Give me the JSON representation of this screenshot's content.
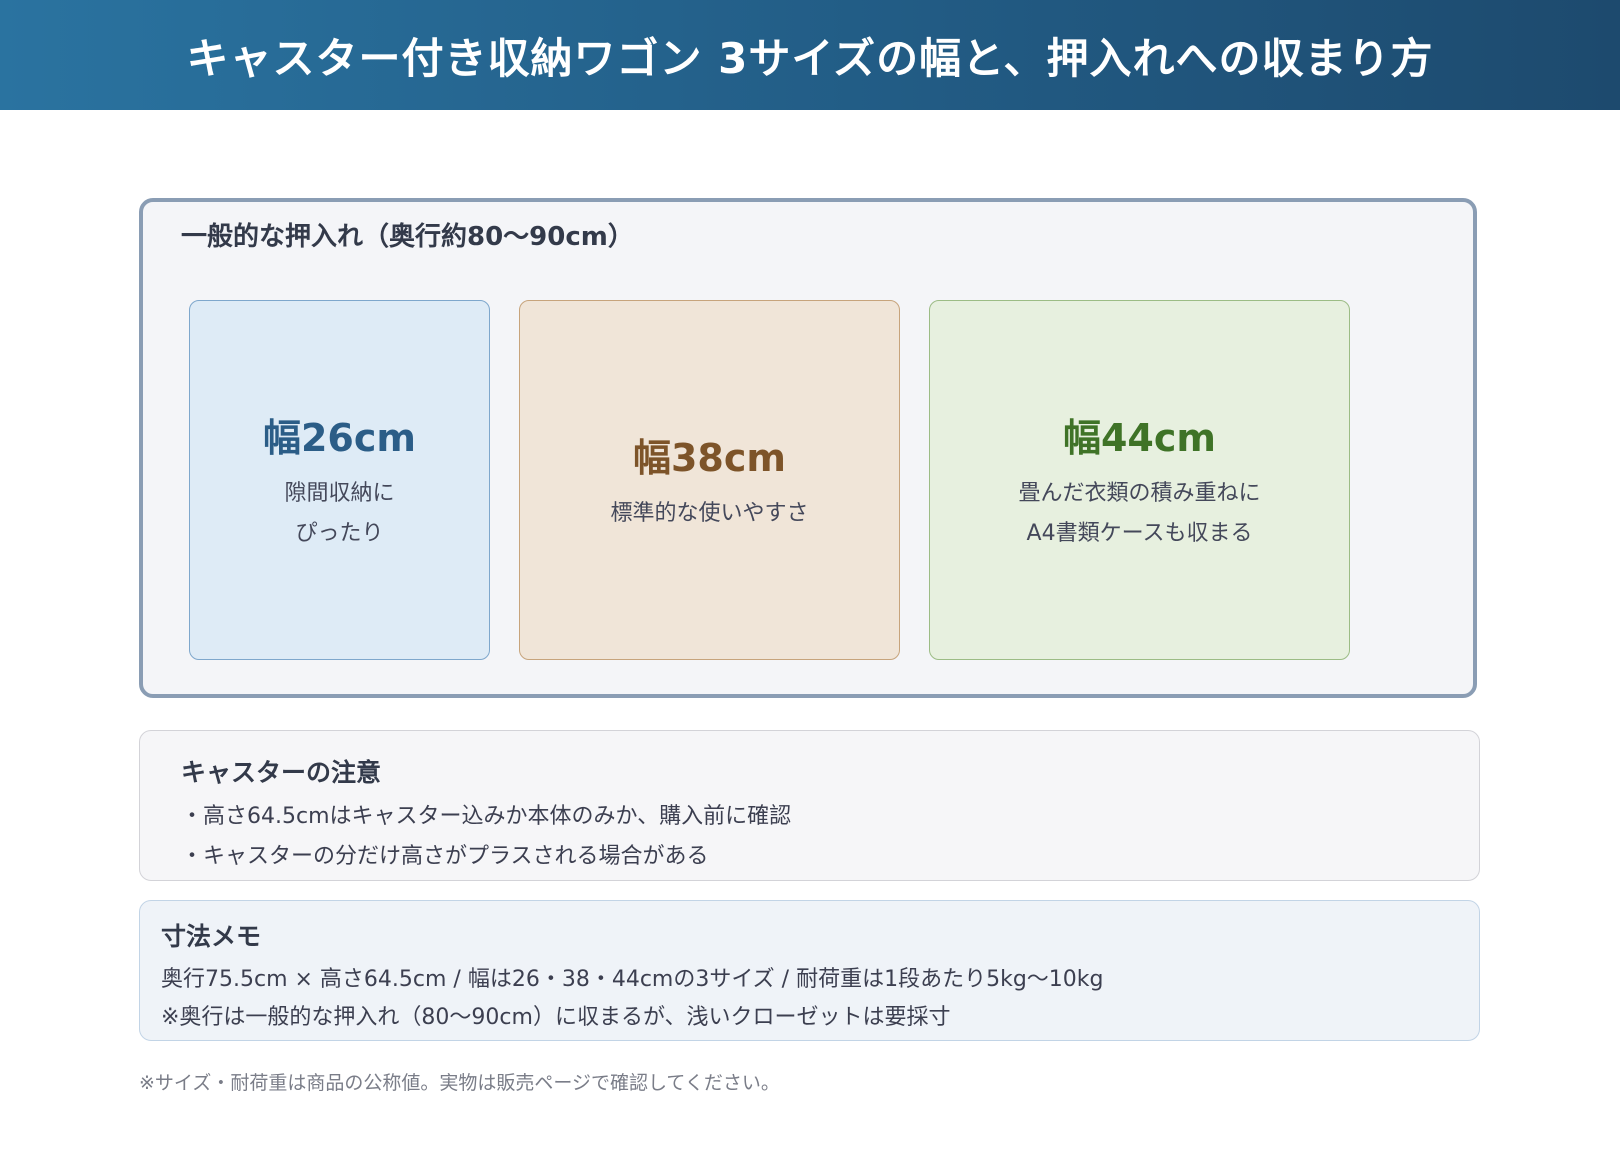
{
  "header": {
    "title": "キャスター付き収納ワゴン 3サイズの幅と、押入れへの収まり方",
    "colors": {
      "gradient_start": "#2a73a0",
      "gradient_end": "#1d4a6e"
    }
  },
  "closet": {
    "label": "一般的な押入れ（奥行約80〜90cm）",
    "wagons": [
      {
        "width_label": "幅26cm",
        "desc": [
          "隙間収納に",
          "ぴったり"
        ],
        "color": "#2b5d87",
        "fill": "#deebf6"
      },
      {
        "width_label": "幅38cm",
        "desc": [
          "標準的な使いやすさ"
        ],
        "color": "#7d5429",
        "fill": "#f0e5d8"
      },
      {
        "width_label": "幅44cm",
        "desc": [
          "畳んだ衣類の積み重ねに",
          "A4書類ケースも収まる"
        ],
        "color": "#3f7327",
        "fill": "#e7f0df"
      }
    ]
  },
  "caution": {
    "title": "キャスターの注意",
    "items": [
      "・高さ64.5cmはキャスター込みか本体のみか、購入前に確認",
      "・キャスターの分だけ高さがプラスされる場合がある"
    ]
  },
  "memo": {
    "title": "寸法メモ",
    "lines": [
      "奥行75.5cm × 高さ64.5cm / 幅は26・38・44cmの3サイズ / 耐荷重は1段あたり5kg〜10kg",
      "※奥行は一般的な押入れ（80〜90cm）に収まるが、浅いクローゼットは要採寸"
    ]
  },
  "footnote": "※サイズ・耐荷重は商品の公称値。実物は販売ページで確認してください。"
}
